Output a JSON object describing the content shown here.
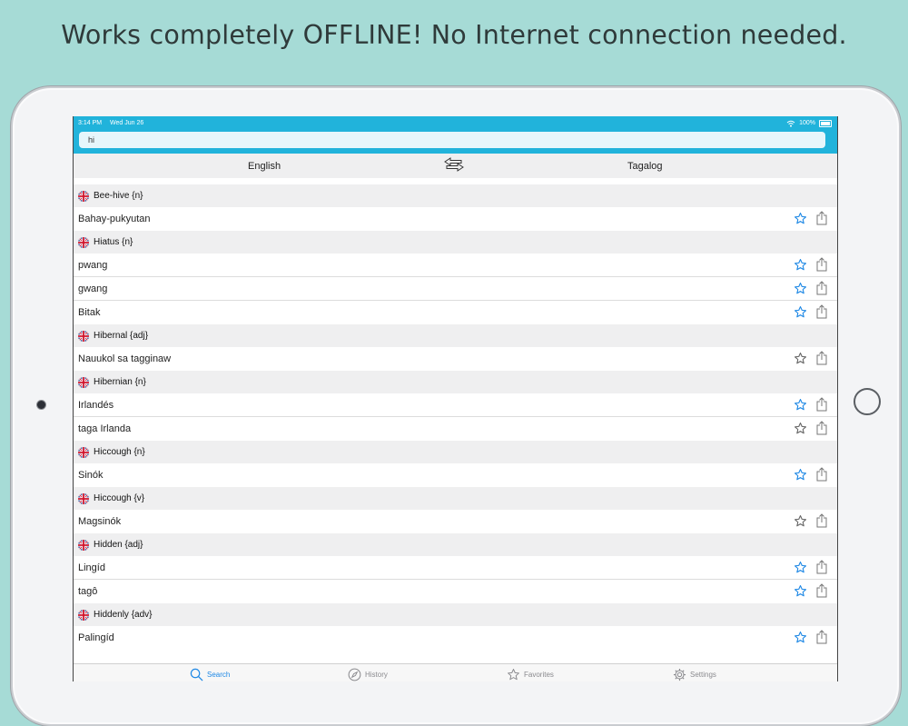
{
  "headline": "Works completely OFFLINE! No Internet connection needed.",
  "status_bar": {
    "time": "3:14 PM",
    "date": "Wed Jun 26",
    "battery": "100%"
  },
  "search": {
    "value": "hi",
    "placeholder": ""
  },
  "languages": {
    "source": "English",
    "target": "Tagalog"
  },
  "entries": [
    {
      "headword": "Bee-hive {n}",
      "translations": [
        {
          "text": "Bahay-pukyutan",
          "favorited": true
        }
      ]
    },
    {
      "headword": "Hiatus {n}",
      "translations": [
        {
          "text": "pwang",
          "favorited": true
        },
        {
          "text": "gwang",
          "favorited": true
        },
        {
          "text": "Bitak",
          "favorited": true
        }
      ]
    },
    {
      "headword": "Hibernal {adj}",
      "translations": [
        {
          "text": "Nauukol sa tagginaw",
          "favorited": false
        }
      ]
    },
    {
      "headword": "Hibernian {n}",
      "translations": [
        {
          "text": "Irlandés",
          "favorited": true
        },
        {
          "text": "taga Irlanda",
          "favorited": false
        }
      ]
    },
    {
      "headword": "Hiccough {n}",
      "translations": [
        {
          "text": "Sinók",
          "favorited": true
        }
      ]
    },
    {
      "headword": "Hiccough {v}",
      "translations": [
        {
          "text": "Magsinók",
          "favorited": false
        }
      ]
    },
    {
      "headword": "Hidden {adj}",
      "translations": [
        {
          "text": "Lingíd",
          "favorited": true
        },
        {
          "text": "tagô",
          "favorited": true
        }
      ]
    },
    {
      "headword": "Hiddenly {adv}",
      "translations": [
        {
          "text": "Palingíd",
          "favorited": true
        }
      ]
    }
  ],
  "tabs": [
    {
      "label": "Search",
      "icon": "search-icon",
      "active": true
    },
    {
      "label": "History",
      "icon": "compass-icon",
      "active": false
    },
    {
      "label": "Favorites",
      "icon": "star-icon",
      "active": false
    },
    {
      "label": "Settings",
      "icon": "gear-icon",
      "active": false
    }
  ],
  "colors": {
    "background": "#a6dbd6",
    "accent": "#21b3db",
    "favorite_active": "#1e88e5",
    "favorite_inactive": "#666666"
  }
}
